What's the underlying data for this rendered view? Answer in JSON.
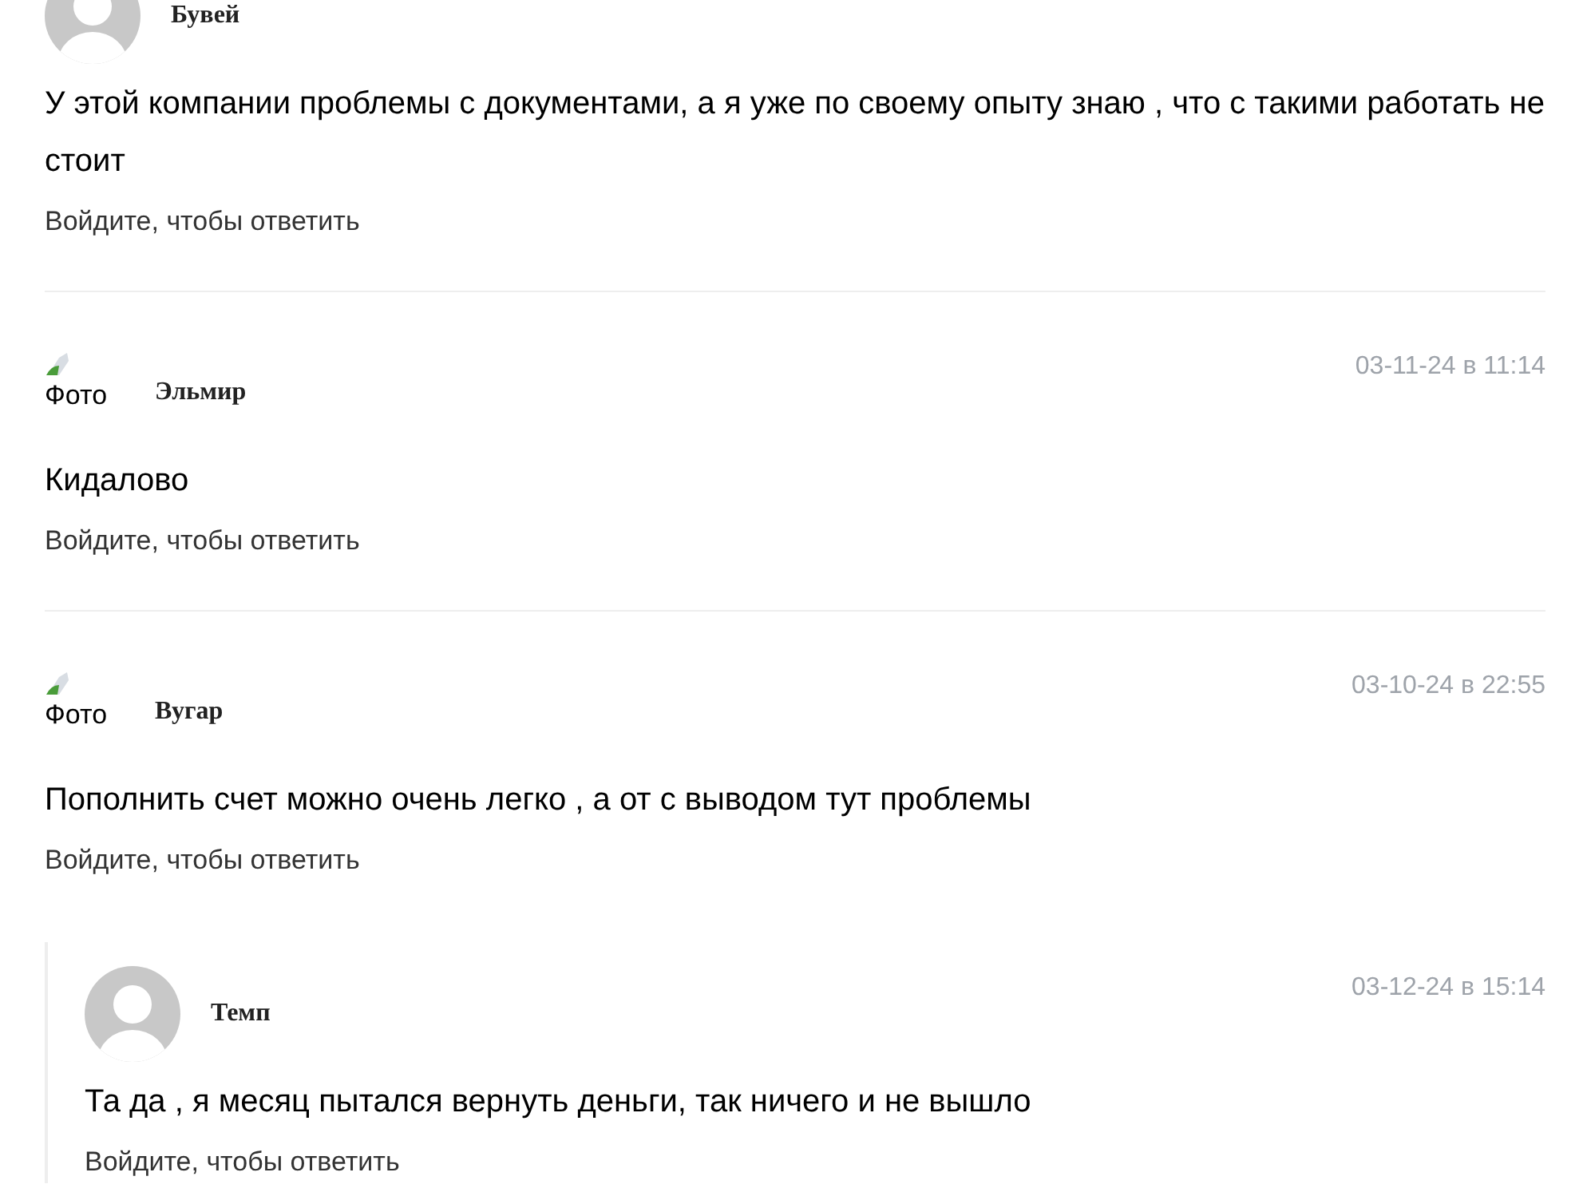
{
  "comments": [
    {
      "author": "Бувей",
      "avatar": {
        "kind": "silhouette"
      },
      "text": "У этой компании проблемы с документами, а я уже по своему опыту знаю , что с такими работать не стоит",
      "reply_link": "Войдите, чтобы ответить"
    },
    {
      "author": "Эльмир",
      "date": "03-11-24 в 11:14",
      "avatar": {
        "kind": "broken",
        "alt": "Фото"
      },
      "text": "Кидалово",
      "reply_link": "Войдите, чтобы ответить"
    },
    {
      "author": "Вугар",
      "date": "03-10-24 в 22:55",
      "avatar": {
        "kind": "broken",
        "alt": "Фото"
      },
      "text": "Пополнить счет можно очень легко , а от с выводом тут проблемы",
      "reply_link": "Войдите, чтобы ответить",
      "replies": [
        {
          "author": "Темп",
          "date": "03-12-24 в 15:14",
          "avatar": {
            "kind": "silhouette"
          },
          "text": "Та да , я месяц пытался вернуть деньги, так ничего и не вышло",
          "reply_link": "Войдите, чтобы ответить"
        }
      ]
    }
  ]
}
